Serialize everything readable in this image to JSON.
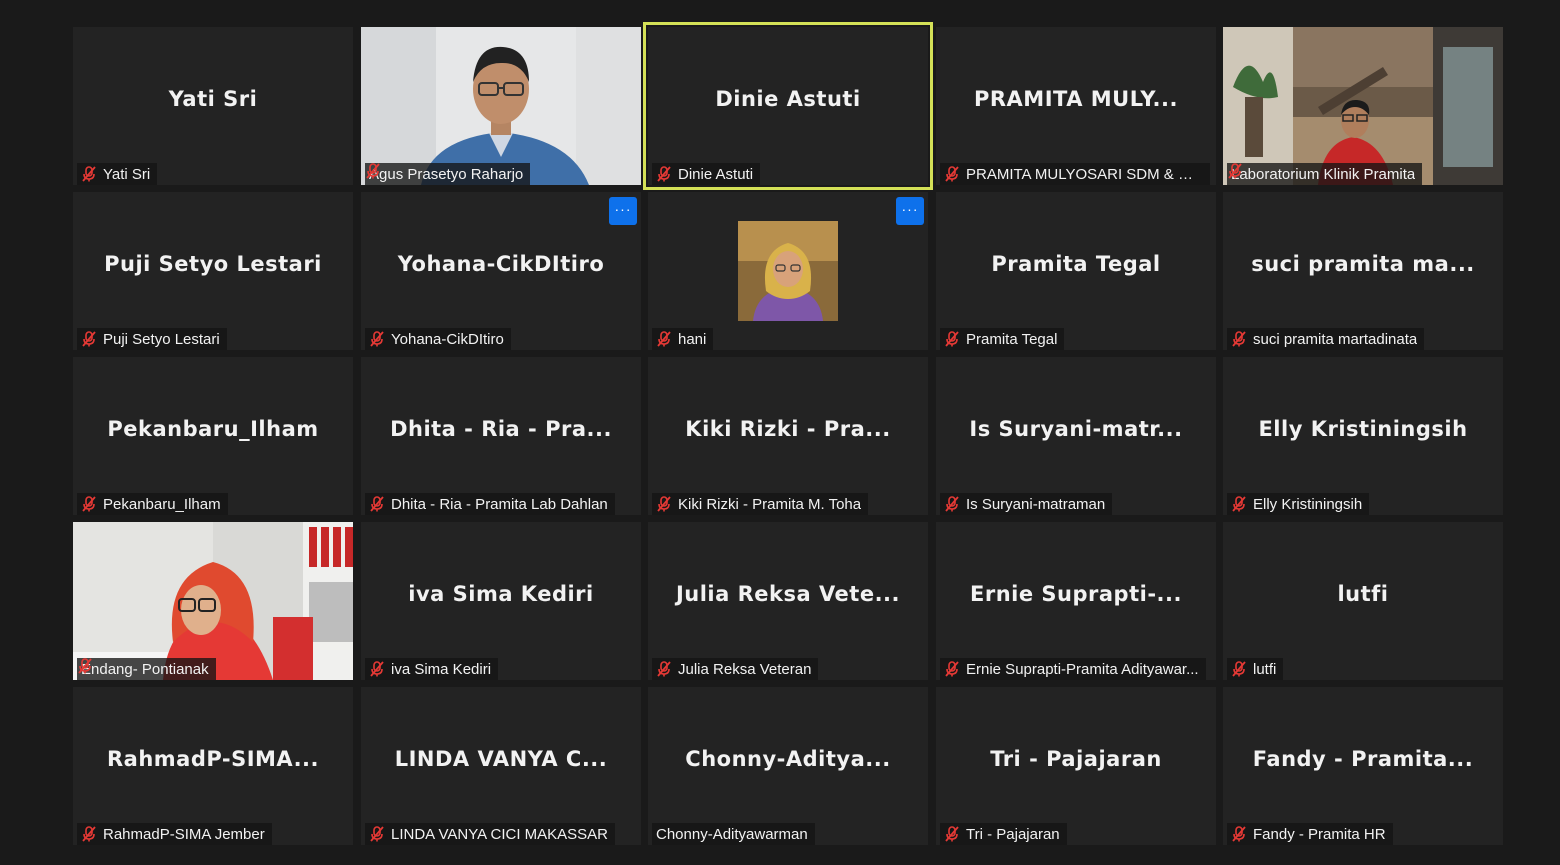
{
  "participants": [
    {
      "big_name": "Yati Sri",
      "label": "Yati Sri"
    },
    {
      "big_name": "",
      "label": "Agus Prasetyo Raharjo"
    },
    {
      "big_name": "Dinie Astuti",
      "label": "Dinie Astuti"
    },
    {
      "big_name": "PRAMITA  MULY...",
      "label": "PRAMITA MULYOSARI SDM & UM..."
    },
    {
      "big_name": "",
      "label": "Laboratorium Klinik Pramita"
    },
    {
      "big_name": "Puji Setyo Lestari",
      "label": "Puji Setyo Lestari"
    },
    {
      "big_name": "Yohana-CikDItiro",
      "label": "Yohana-CikDItiro"
    },
    {
      "big_name": "",
      "label": "hani"
    },
    {
      "big_name": "Pramita Tegal",
      "label": "Pramita Tegal"
    },
    {
      "big_name": "suci  pramita  ma...",
      "label": "suci pramita martadinata"
    },
    {
      "big_name": "Pekanbaru_Ilham",
      "label": "Pekanbaru_Ilham"
    },
    {
      "big_name": "Dhita  -  Ria  -  Pra...",
      "label": "Dhita - Ria - Pramita Lab Dahlan"
    },
    {
      "big_name": "Kiki Rizki  -  Pra...",
      "label": "Kiki Rizki - Pramita M. Toha"
    },
    {
      "big_name": "Is  Suryani-matr...",
      "label": "Is Suryani-matraman"
    },
    {
      "big_name": "Elly Kristiningsih",
      "label": "Elly Kristiningsih"
    },
    {
      "big_name": "",
      "label": "Endang- Pontianak"
    },
    {
      "big_name": "iva Sima Kediri",
      "label": "iva Sima Kediri"
    },
    {
      "big_name": "Julia  Reksa  Vete...",
      "label": "Julia Reksa Veteran"
    },
    {
      "big_name": "Ernie  Suprapti-...",
      "label": "Ernie Suprapti-Pramita Adityawar..."
    },
    {
      "big_name": "lutfi",
      "label": "lutfi"
    },
    {
      "big_name": "RahmadP-SIMA...",
      "label": "RahmadP-SIMA Jember"
    },
    {
      "big_name": "LINDA  VANYA  C...",
      "label": "LINDA VANYA CICI MAKASSAR"
    },
    {
      "big_name": "Chonny-Aditya...",
      "label": "Chonny-Adityawarman"
    },
    {
      "big_name": "Tri  -  Pajajaran",
      "label": "Tri - Pajajaran"
    },
    {
      "big_name": "Fandy  -  Pramita...",
      "label": "Fandy - Pramita HR"
    }
  ],
  "more_button_label": "···",
  "colors": {
    "background": "#1a1a1a",
    "tile": "#232323",
    "speaker_border": "#d4e157",
    "more_button": "#0e71eb",
    "muted_icon": "#e53935"
  }
}
